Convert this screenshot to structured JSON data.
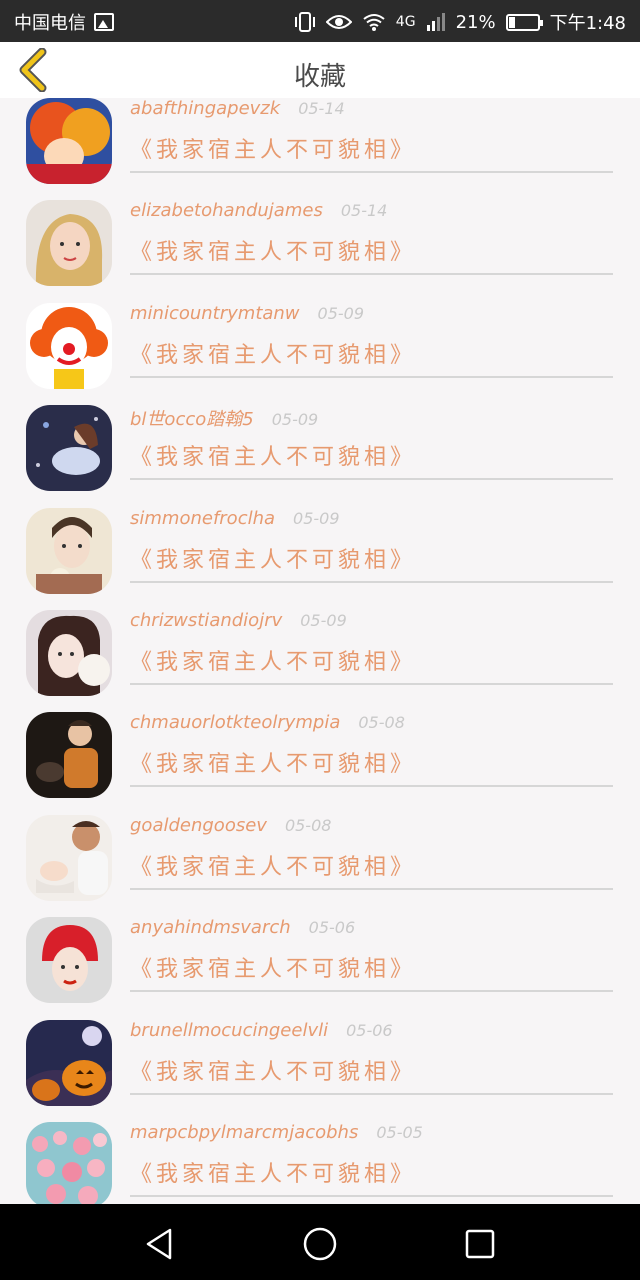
{
  "status_bar": {
    "carrier": "中国电信",
    "network": "4G",
    "battery_percent": "21%",
    "battery_level": 0.21,
    "time": "下午1:48",
    "icons": [
      "image-icon",
      "vibrate-icon",
      "eye-icon",
      "wifi-icon",
      "signal-icon",
      "battery-icon"
    ]
  },
  "header": {
    "title": "收藏",
    "back_icon": "chevron-left-icon"
  },
  "favorites": [
    {
      "user": "abafthingapevzk",
      "date": "05-14",
      "book": "《我家宿主人不可貌相》"
    },
    {
      "user": "elizabetohandujames",
      "date": "05-14",
      "book": "《我家宿主人不可貌相》"
    },
    {
      "user": "minicountrymtanw",
      "date": "05-09",
      "book": "《我家宿主人不可貌相》"
    },
    {
      "user": "bl世occo踏翰5",
      "date": "05-09",
      "book": "《我家宿主人不可貌相》"
    },
    {
      "user": "simmonefroclha",
      "date": "05-09",
      "book": "《我家宿主人不可貌相》"
    },
    {
      "user": "chrizwstiandiojrv",
      "date": "05-09",
      "book": "《我家宿主人不可貌相》"
    },
    {
      "user": "chmauorlotkteolrympia",
      "date": "05-08",
      "book": "《我家宿主人不可貌相》"
    },
    {
      "user": "goaldengoosev",
      "date": "05-08",
      "book": "《我家宿主人不可貌相》"
    },
    {
      "user": "anyahindmsvarch",
      "date": "05-06",
      "book": "《我家宿主人不可貌相》"
    },
    {
      "user": "brunellmocucingeelvli",
      "date": "05-06",
      "book": "《我家宿主人不可貌相》"
    },
    {
      "user": "marpcbpylmarcmjacobhs",
      "date": "05-05",
      "book": "《我家宿主人不可貌相》"
    }
  ],
  "colors": {
    "accent": "#e79a6f",
    "date": "#c9c9c9",
    "back_icon": "#f0c419",
    "status_bar": "#2b2b2b",
    "nav_bar": "#000000"
  },
  "nav_bar": {
    "icons": [
      "back-triangle-icon",
      "home-circle-icon",
      "recents-square-icon"
    ]
  }
}
